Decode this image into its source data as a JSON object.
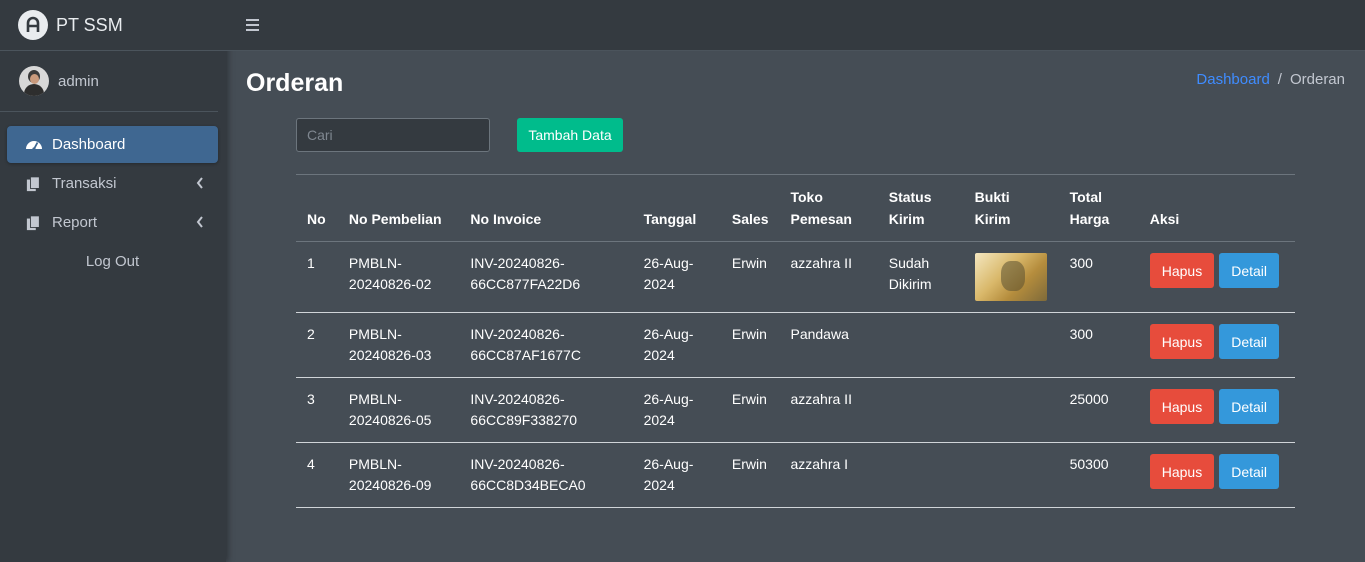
{
  "brand": {
    "name": "PT SSM",
    "logo_icon": "brand-logo-icon"
  },
  "user": {
    "name": "admin"
  },
  "sidebar": {
    "items": [
      {
        "label": "Dashboard",
        "icon": "tachometer-icon",
        "active": true
      },
      {
        "label": "Transaksi",
        "icon": "copy-icon",
        "has_submenu": true
      },
      {
        "label": "Report",
        "icon": "copy-icon",
        "has_submenu": true
      },
      {
        "label": "Log Out"
      }
    ]
  },
  "topbar": {
    "menu_icon": "hamburger-icon"
  },
  "page": {
    "title": "Orderan",
    "breadcrumb": {
      "home": "Dashboard",
      "separator": "/",
      "current": "Orderan"
    }
  },
  "search": {
    "placeholder": "Cari",
    "value": ""
  },
  "actions": {
    "add_label": "Tambah Data"
  },
  "table": {
    "headers": [
      "No",
      "No Pembelian",
      "No Invoice",
      "Tanggal",
      "Sales",
      "Toko Pemesan",
      "Status Kirim",
      "Bukti Kirim",
      "Total Harga",
      "Aksi"
    ],
    "rows": [
      {
        "no": "1",
        "no_pembelian": "PMBLN-20240826-02",
        "no_invoice": "INV-20240826-66CC877FA22D6",
        "tanggal": "26-Aug-2024",
        "sales": "Erwin",
        "toko": "azzahra II",
        "status": "Sudah Dikirim",
        "has_bukti": true,
        "total": "300"
      },
      {
        "no": "2",
        "no_pembelian": "PMBLN-20240826-03",
        "no_invoice": "INV-20240826-66CC87AF1677C",
        "tanggal": "26-Aug-2024",
        "sales": "Erwin",
        "toko": "Pandawa",
        "status": "",
        "has_bukti": false,
        "total": "300"
      },
      {
        "no": "3",
        "no_pembelian": "PMBLN-20240826-05",
        "no_invoice": "INV-20240826-66CC89F338270",
        "tanggal": "26-Aug-2024",
        "sales": "Erwin",
        "toko": "azzahra II",
        "status": "",
        "has_bukti": false,
        "total": "25000"
      },
      {
        "no": "4",
        "no_pembelian": "PMBLN-20240826-09",
        "no_invoice": "INV-20240826-66CC8D34BECA0",
        "tanggal": "26-Aug-2024",
        "sales": "Erwin",
        "toko": "azzahra I",
        "status": "",
        "has_bukti": false,
        "total": "50300"
      }
    ],
    "row_actions": {
      "delete_label": "Hapus",
      "detail_label": "Detail"
    }
  },
  "colors": {
    "sidebar_bg": "#343a40",
    "content_bg": "#454d55",
    "active_nav": "#3f6791",
    "success": "#00bc8c",
    "danger": "#e74c3c",
    "info": "#3498db",
    "link": "#3f8cff"
  }
}
